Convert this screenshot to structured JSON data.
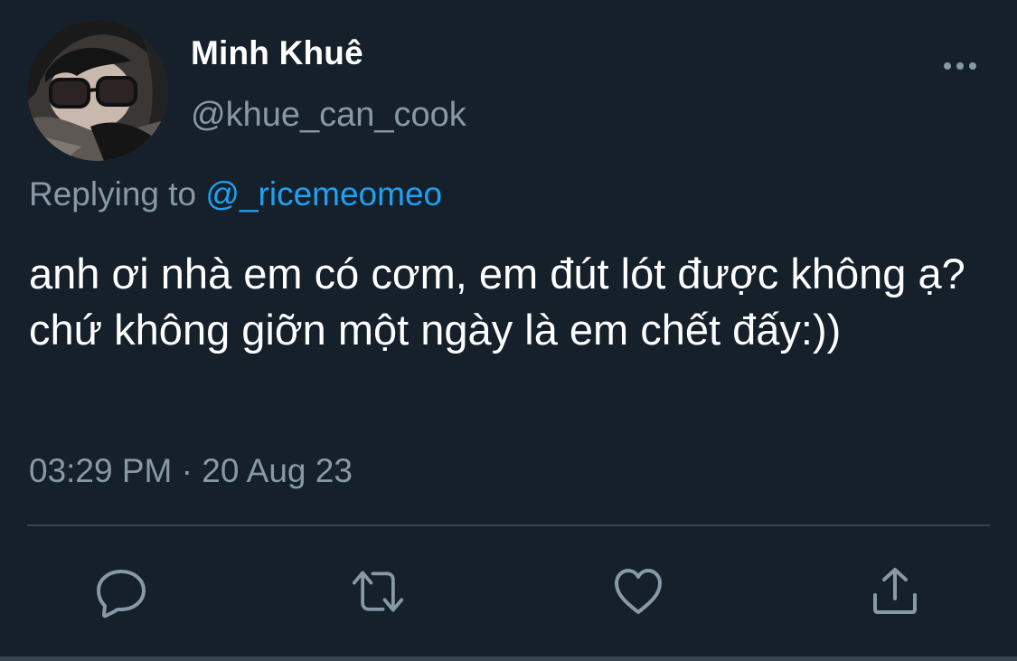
{
  "author": {
    "display_name": "Minh Khuê",
    "handle": "@khue_can_cook",
    "avatar_icon": "user-avatar-photo"
  },
  "reply": {
    "prefix": "Replying to",
    "mention": "@_ricemeomeo"
  },
  "tweet": {
    "text": "anh ơi nhà em có cơm, em đút lót được không ạ? chứ không giỡn một ngày là em chết đấy:))"
  },
  "meta": {
    "timestamp": "03:29 PM · 20 Aug 23"
  },
  "actions": {
    "reply_icon": "comment-icon",
    "retweet_icon": "retweet-icon",
    "like_icon": "heart-icon",
    "share_icon": "share-icon"
  },
  "colors": {
    "background": "#15202b",
    "text_primary": "#ffffff",
    "text_secondary": "#8899a6",
    "accent": "#1da1f2",
    "divider": "#38444d"
  }
}
